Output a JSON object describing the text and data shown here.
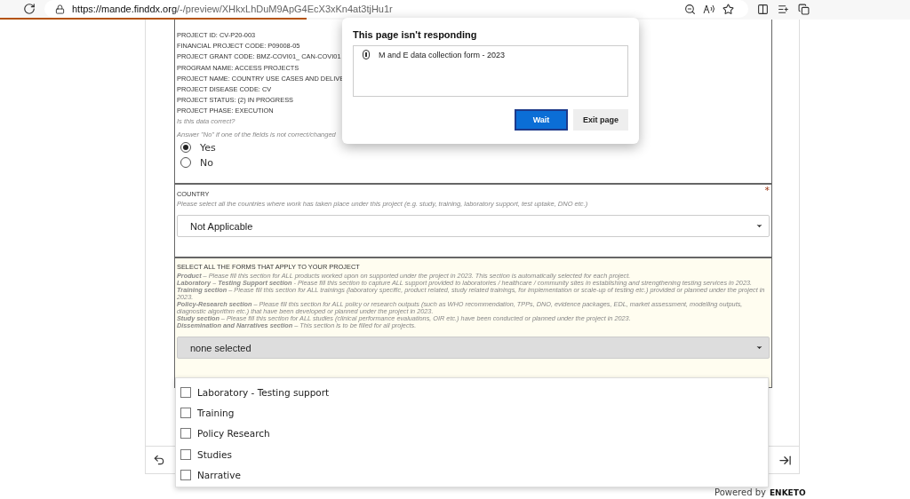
{
  "browser": {
    "url_host": "https://mande.finddx.org",
    "url_path": "/-/preview/XHkxLhDuM9ApG4EcX3xKn4at3tjHu1r"
  },
  "progress": {
    "level": 0.337
  },
  "form": {
    "project_lines": [
      "PROJECT ID: CV-P20-003",
      "FINANCIAL PROJECT CODE: P09008-05",
      "PROJECT GRANT CODE: BMZ-COVI01_ CAN-COVI01",
      "PROGRAM NAME: ACCESS PROJECTS",
      "PROJECT NAME: COUNTRY USE CASES AND DELIVE",
      "PROJECT DISEASE CODE: CV",
      "PROJECT STATUS: (2) IN PROGRESS",
      "PROJECT PHASE: EXECUTION"
    ],
    "question_hint": "Is this data correct?",
    "answer_hint": "Answer \"No\" if one of the fields is not correct/changed",
    "options": [
      {
        "label": "Yes",
        "selected": true
      },
      {
        "label": "No",
        "selected": false
      }
    ],
    "country": {
      "label": "COUNTRY",
      "required_mark": "*",
      "hint": "Please select all the countries where work has taken place under this project (e.g. study, training, laboratory support, test uptake, DNO etc.)",
      "value": "Not Applicable"
    },
    "forms_question": {
      "label": "SELECT ALL THE FORMS THAT APPLY TO YOUR PROJECT",
      "hints": [
        "**Product** – Please fill this section for ALL products worked upon on supported under the project in 2023. This section is automatically selected for each project.",
        "**Laboratory – Testing Support section** - Please fill this section to capture ALL support provided to laboratories / healthcare / community sites in establishing and strengthening testing services in 2023.",
        "**Training section** – Please fill this section for ALL trainings (laboratory specific, product related, study related trainings, for implementation or scale-up of testing etc.) provided or planned under the project in 2023.",
        "**Policy-Research section** – Please fill this section for ALL policy or research outputs (such as WHO recommendation, TPPs, DNO, evidence packages, EDL, market assessment, modelling outputs, diagnostic algorithm etc.) that have been developed or planned under the project in 2023.",
        "**Study section** – Please fill this section for ALL studies (clinical performance evaluations, OIR etc.) have been conducted or planned under the project in 2023.",
        "**Dissemination and Narratives section** – This section is to be filled for all projects."
      ],
      "value": "none selected",
      "choices": [
        {
          "label": "Laboratory - Testing support",
          "checked": false
        },
        {
          "label": "Training",
          "checked": false
        },
        {
          "label": "Policy Research",
          "checked": false
        },
        {
          "label": "Studies",
          "checked": false
        },
        {
          "label": "Narrative",
          "checked": false
        }
      ]
    }
  },
  "footer": {
    "powered_by": "Powered by",
    "brand": "ENKETO"
  },
  "dialog": {
    "title": "This page isn't responding",
    "pages": [
      "M and E data collection form - 2023"
    ],
    "buttons": [
      {
        "label": "Wait",
        "primary": true
      },
      {
        "label": "Exit page",
        "primary": false
      }
    ]
  }
}
